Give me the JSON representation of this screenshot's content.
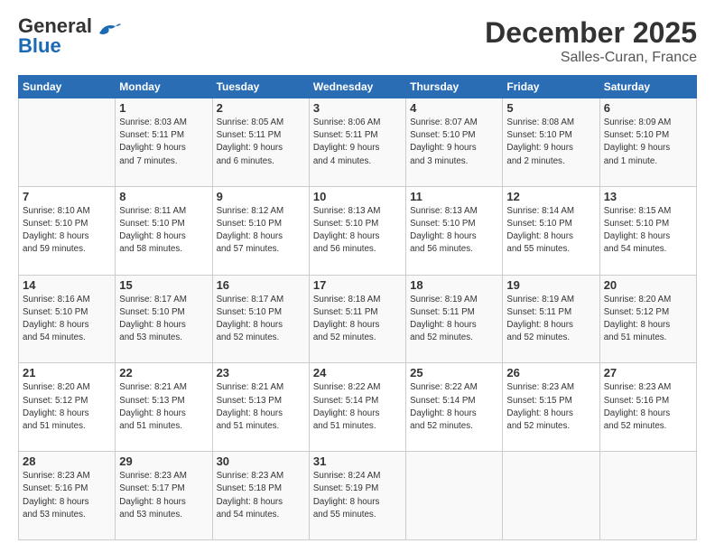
{
  "header": {
    "logo_general": "General",
    "logo_blue": "Blue",
    "month": "December 2025",
    "location": "Salles-Curan, France"
  },
  "days_of_week": [
    "Sunday",
    "Monday",
    "Tuesday",
    "Wednesday",
    "Thursday",
    "Friday",
    "Saturday"
  ],
  "weeks": [
    [
      {
        "day": "",
        "info": ""
      },
      {
        "day": "1",
        "info": "Sunrise: 8:03 AM\nSunset: 5:11 PM\nDaylight: 9 hours\nand 7 minutes."
      },
      {
        "day": "2",
        "info": "Sunrise: 8:05 AM\nSunset: 5:11 PM\nDaylight: 9 hours\nand 6 minutes."
      },
      {
        "day": "3",
        "info": "Sunrise: 8:06 AM\nSunset: 5:11 PM\nDaylight: 9 hours\nand 4 minutes."
      },
      {
        "day": "4",
        "info": "Sunrise: 8:07 AM\nSunset: 5:10 PM\nDaylight: 9 hours\nand 3 minutes."
      },
      {
        "day": "5",
        "info": "Sunrise: 8:08 AM\nSunset: 5:10 PM\nDaylight: 9 hours\nand 2 minutes."
      },
      {
        "day": "6",
        "info": "Sunrise: 8:09 AM\nSunset: 5:10 PM\nDaylight: 9 hours\nand 1 minute."
      }
    ],
    [
      {
        "day": "7",
        "info": "Sunrise: 8:10 AM\nSunset: 5:10 PM\nDaylight: 8 hours\nand 59 minutes."
      },
      {
        "day": "8",
        "info": "Sunrise: 8:11 AM\nSunset: 5:10 PM\nDaylight: 8 hours\nand 58 minutes."
      },
      {
        "day": "9",
        "info": "Sunrise: 8:12 AM\nSunset: 5:10 PM\nDaylight: 8 hours\nand 57 minutes."
      },
      {
        "day": "10",
        "info": "Sunrise: 8:13 AM\nSunset: 5:10 PM\nDaylight: 8 hours\nand 56 minutes."
      },
      {
        "day": "11",
        "info": "Sunrise: 8:13 AM\nSunset: 5:10 PM\nDaylight: 8 hours\nand 56 minutes."
      },
      {
        "day": "12",
        "info": "Sunrise: 8:14 AM\nSunset: 5:10 PM\nDaylight: 8 hours\nand 55 minutes."
      },
      {
        "day": "13",
        "info": "Sunrise: 8:15 AM\nSunset: 5:10 PM\nDaylight: 8 hours\nand 54 minutes."
      }
    ],
    [
      {
        "day": "14",
        "info": "Sunrise: 8:16 AM\nSunset: 5:10 PM\nDaylight: 8 hours\nand 54 minutes."
      },
      {
        "day": "15",
        "info": "Sunrise: 8:17 AM\nSunset: 5:10 PM\nDaylight: 8 hours\nand 53 minutes."
      },
      {
        "day": "16",
        "info": "Sunrise: 8:17 AM\nSunset: 5:10 PM\nDaylight: 8 hours\nand 52 minutes."
      },
      {
        "day": "17",
        "info": "Sunrise: 8:18 AM\nSunset: 5:11 PM\nDaylight: 8 hours\nand 52 minutes."
      },
      {
        "day": "18",
        "info": "Sunrise: 8:19 AM\nSunset: 5:11 PM\nDaylight: 8 hours\nand 52 minutes."
      },
      {
        "day": "19",
        "info": "Sunrise: 8:19 AM\nSunset: 5:11 PM\nDaylight: 8 hours\nand 52 minutes."
      },
      {
        "day": "20",
        "info": "Sunrise: 8:20 AM\nSunset: 5:12 PM\nDaylight: 8 hours\nand 51 minutes."
      }
    ],
    [
      {
        "day": "21",
        "info": "Sunrise: 8:20 AM\nSunset: 5:12 PM\nDaylight: 8 hours\nand 51 minutes."
      },
      {
        "day": "22",
        "info": "Sunrise: 8:21 AM\nSunset: 5:13 PM\nDaylight: 8 hours\nand 51 minutes."
      },
      {
        "day": "23",
        "info": "Sunrise: 8:21 AM\nSunset: 5:13 PM\nDaylight: 8 hours\nand 51 minutes."
      },
      {
        "day": "24",
        "info": "Sunrise: 8:22 AM\nSunset: 5:14 PM\nDaylight: 8 hours\nand 51 minutes."
      },
      {
        "day": "25",
        "info": "Sunrise: 8:22 AM\nSunset: 5:14 PM\nDaylight: 8 hours\nand 52 minutes."
      },
      {
        "day": "26",
        "info": "Sunrise: 8:23 AM\nSunset: 5:15 PM\nDaylight: 8 hours\nand 52 minutes."
      },
      {
        "day": "27",
        "info": "Sunrise: 8:23 AM\nSunset: 5:16 PM\nDaylight: 8 hours\nand 52 minutes."
      }
    ],
    [
      {
        "day": "28",
        "info": "Sunrise: 8:23 AM\nSunset: 5:16 PM\nDaylight: 8 hours\nand 53 minutes."
      },
      {
        "day": "29",
        "info": "Sunrise: 8:23 AM\nSunset: 5:17 PM\nDaylight: 8 hours\nand 53 minutes."
      },
      {
        "day": "30",
        "info": "Sunrise: 8:23 AM\nSunset: 5:18 PM\nDaylight: 8 hours\nand 54 minutes."
      },
      {
        "day": "31",
        "info": "Sunrise: 8:24 AM\nSunset: 5:19 PM\nDaylight: 8 hours\nand 55 minutes."
      },
      {
        "day": "",
        "info": ""
      },
      {
        "day": "",
        "info": ""
      },
      {
        "day": "",
        "info": ""
      }
    ]
  ]
}
